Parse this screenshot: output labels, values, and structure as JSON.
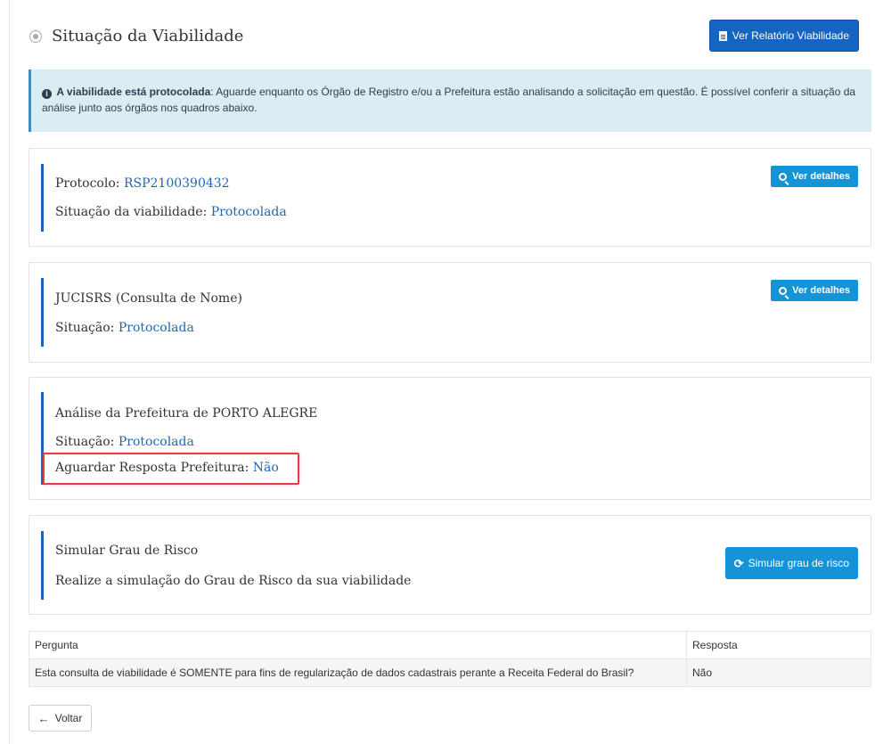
{
  "header": {
    "title": "Situação da Viabilidade",
    "report_button": "Ver Relatório Viabilidade"
  },
  "alert": {
    "bold": "A viabilidade está protocolada",
    "text": ": Aguarde enquanto os Órgão de Registro e/ou a Prefeitura estão analisando a solicitação em questão. É possível conferir a situação da análise junto aos órgãos nos quadros abaixo."
  },
  "protocol_card": {
    "protocol_label": "Protocolo: ",
    "protocol_value": "RSP2100390432",
    "status_label": "Situação da viabilidade: ",
    "status_value": "Protocolada",
    "button": "Ver detalhes"
  },
  "jucis_card": {
    "title": "JUCISRS (Consulta de Nome)",
    "status_label": "Situação: ",
    "status_value": "Protocolada",
    "button": "Ver detalhes"
  },
  "prefeitura_card": {
    "title": "Análise da Prefeitura de PORTO ALEGRE",
    "status_label": "Situação: ",
    "status_value": "Protocolada",
    "wait_label": "Aguardar Resposta Prefeitura: ",
    "wait_value": "Não"
  },
  "risk_card": {
    "title": "Simular Grau de Risco",
    "subtitle": "Realize a simulação do Grau de Risco da sua viabilidade",
    "button": "Simular grau de risco"
  },
  "table": {
    "headers": [
      "Pergunta",
      "Resposta"
    ],
    "rows": [
      [
        "Esta consulta de viabilidade é SOMENTE para fins de regularização de dados cadastrais perante a Receita Federal do Brasil?",
        "Não"
      ]
    ]
  },
  "back_button": "Voltar",
  "colors": {
    "primary": "#1565c0",
    "info_button": "#1593d6",
    "link_value": "#1e66b5",
    "accent_border": "#1c62b9",
    "alert_bg": "#d9edf3",
    "highlight": "#e0403f"
  }
}
